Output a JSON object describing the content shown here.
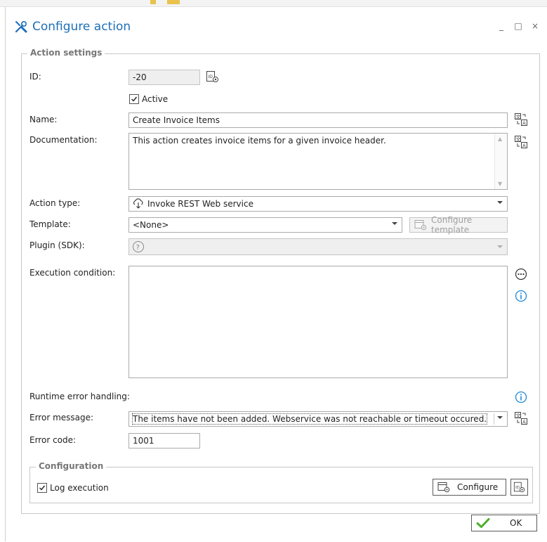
{
  "window": {
    "title": "Configure action",
    "controls": {
      "minimize": "_",
      "maximize": "□",
      "close": "×"
    }
  },
  "action_settings": {
    "legend": "Action settings",
    "id_label": "ID:",
    "id_value": "-20",
    "active_label": "Active",
    "active_checked": true,
    "name_label": "Name:",
    "name_value": "Create Invoice Items",
    "documentation_label": "Documentation:",
    "documentation_value": "This action creates  invoice items for a given invoice header.",
    "action_type_label": "Action type:",
    "action_type_value": "Invoke REST Web service",
    "template_label": "Template:",
    "template_value": "<None>",
    "configure_template_label": "Configure template",
    "plugin_label": "Plugin (SDK):",
    "execution_condition_label": "Execution condition:",
    "execution_condition_value": "",
    "runtime_error_label": "Runtime error handling:",
    "error_message_label": "Error message:",
    "error_message_value": "The items have not been added. Webservice was not reachable or timeout occured.",
    "error_code_label": "Error code:",
    "error_code_value": "1001"
  },
  "configuration": {
    "legend": "Configuration",
    "log_execution_label": "Log execution",
    "log_execution_checked": true,
    "configure_label": "Configure"
  },
  "footer": {
    "ok_label": "OK"
  },
  "colors": {
    "accent": "#1e6fb8",
    "info": "#1e88d8",
    "ok_check": "#4caf2a"
  },
  "icons": [
    "wrench-screwdriver-icon",
    "id-config-icon",
    "translate-icon",
    "rest-service-icon",
    "template-config-icon",
    "question-icon",
    "ellipsis-icon",
    "info-icon",
    "checkmark-icon"
  ]
}
